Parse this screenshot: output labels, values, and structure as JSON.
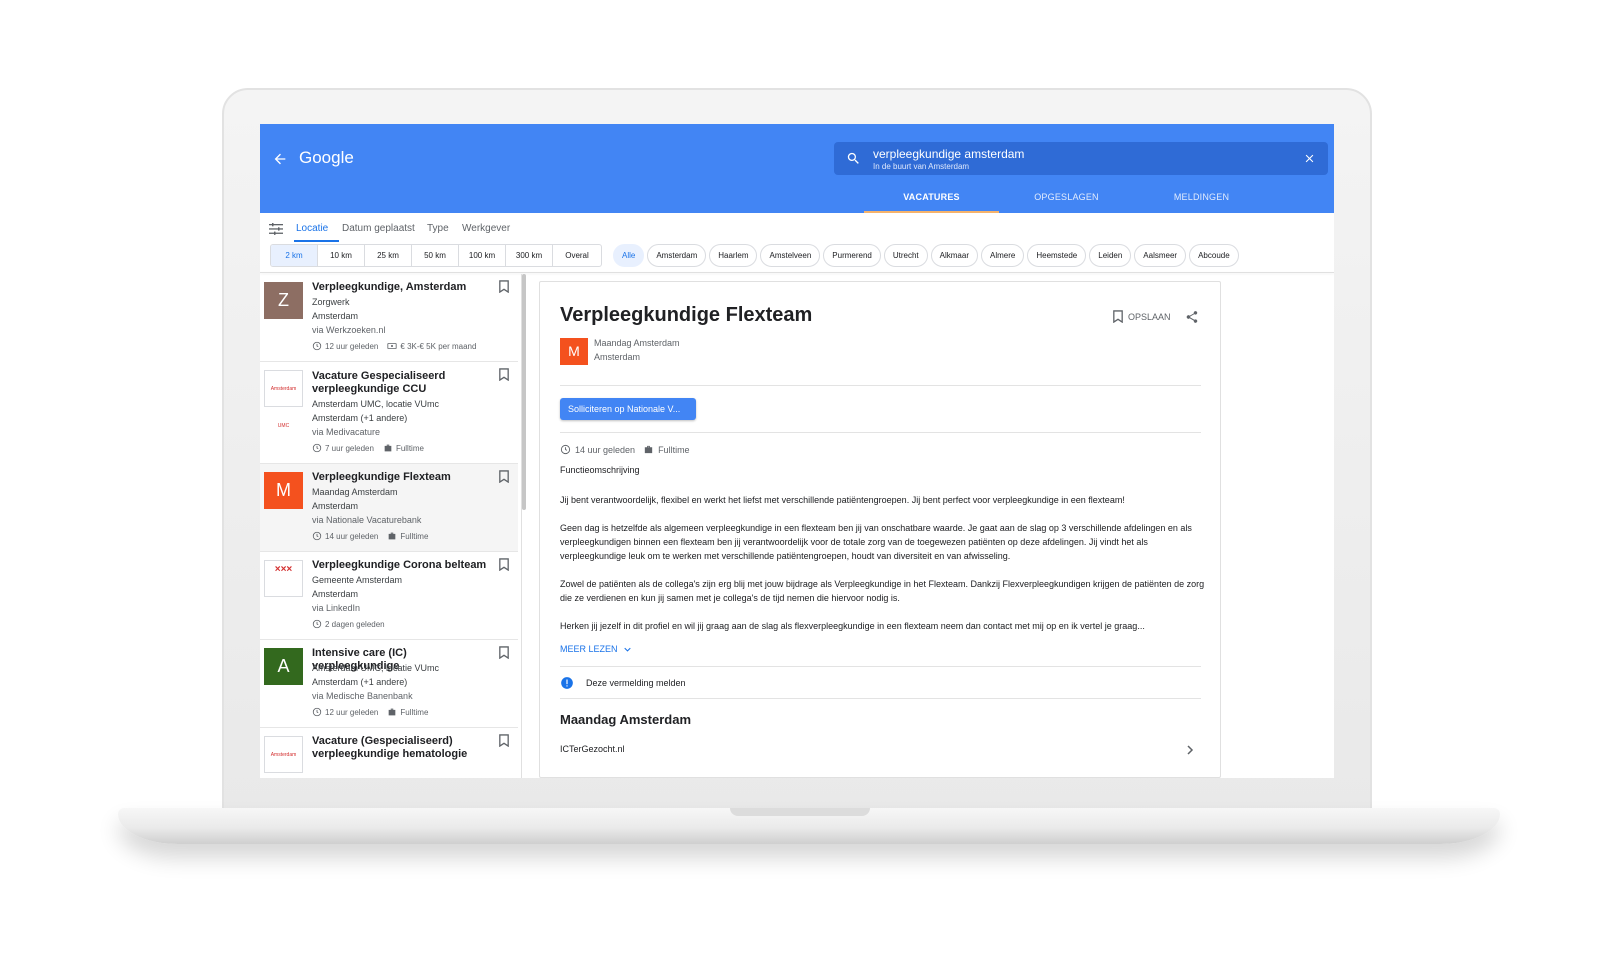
{
  "appbar": {
    "brand": "Google",
    "search_query": "verpleegkundige amsterdam",
    "search_sub": "In de buurt van Amsterdam",
    "tabs": [
      "VACATURES",
      "OPGESLAGEN",
      "MELDINGEN"
    ],
    "color": "#4285f4"
  },
  "filters": {
    "tabs": [
      "Locatie",
      "Datum geplaatst",
      "Type",
      "Werkgever"
    ],
    "distances": [
      "2 km",
      "10 km",
      "25 km",
      "50 km",
      "100 km",
      "300 km",
      "Overal"
    ],
    "chips": [
      "Alle",
      "Amsterdam",
      "Haarlem",
      "Amstelveen",
      "Purmerend",
      "Utrecht",
      "Alkmaar",
      "Almere",
      "Heemstede",
      "Leiden",
      "Aalsmeer",
      "Abcoude"
    ]
  },
  "jobs": [
    {
      "logo": "Z",
      "logo_color": "#8d6e63",
      "title": "Verpleegkundige, Amsterdam",
      "company": "Zorgwerk",
      "location": "Amsterdam",
      "source": "via Werkzoeken.nl",
      "time": "12 uur geleden",
      "extra": "€ 3K-€ 5K per maand"
    },
    {
      "logo": "Amsterdam UMC",
      "title": "Vacature Gespecialiseerd verpleegkundige CCU",
      "company": "Amsterdam UMC, locatie VUmc",
      "location": "Amsterdam (+1 andere)",
      "source": "via Medivacature",
      "time": "7 uur geleden",
      "extra": "Fulltime"
    },
    {
      "logo": "M",
      "logo_color": "#f4511e",
      "title": "Verpleegkundige Flexteam",
      "company": "Maandag Amsterdam",
      "location": "Amsterdam",
      "source": "via Nationale Vacaturebank",
      "time": "14 uur geleden",
      "extra": "Fulltime"
    },
    {
      "logo": "×××",
      "title": "Verpleegkundige Corona belteam",
      "company": "Gemeente Amsterdam",
      "location": "Amsterdam",
      "source": "via LinkedIn",
      "time": "2 dagen geleden"
    },
    {
      "logo": "A",
      "logo_color": "#33691e",
      "title": "Intensive care (IC) verpleegkundige",
      "company": "Amsterdam UMC, locatie VUmc",
      "location": "Amsterdam (+1 andere)",
      "source": "via Medische Banenbank",
      "time": "12 uur geleden",
      "extra": "Fulltime"
    },
    {
      "logo": "Amsterdam UMC",
      "title": "Vacature (Gespecialiseerd) verpleegkundige hematologie"
    }
  ],
  "detail": {
    "title": "Verpleegkundige Flexteam",
    "save": "OPSLAAN",
    "logo": "M",
    "company": "Maandag Amsterdam",
    "location": "Amsterdam",
    "apply": "Solliciteren op Nationale V...",
    "time": "14 uur geleden",
    "type": "Fulltime",
    "heading": "Functieomschrijving",
    "paragraphs": [
      "Jij bent verantwoordelijk, flexibel en werkt het liefst met verschillende patiëntengroepen. Jij bent perfect voor verpleegkundige in een flexteam!",
      "Geen dag is hetzelfde als algemeen verpleegkundige in een flexteam ben jij van onschatbare waarde. Je gaat aan de slag op 3 verschillende afdelingen en als verpleegkundigen binnen een flexteam ben jij verantwoordelijk voor de totale zorg van de toegewezen patiënten op deze afdelingen. Jij vindt het als verpleegkundige leuk om te werken met verschillende patiëntengroepen, houdt van diversiteit en van afwisseling.",
      "Zowel de patiënten als de collega's zijn erg blij met jouw bijdrage als Verpleegkundige in het Flexteam. Dankzij Flexverpleegkundigen krijgen de patiënten de zorg die ze verdienen en kun jij samen met je collega's de tijd nemen die hiervoor nodig is.",
      "Herken jij jezelf in dit profiel en wil jij graag aan de slag als flexverpleegkundige in een flexteam neem dan contact met mij op en ik vertel je graag..."
    ],
    "more": "MEER LEZEN",
    "report": "Deze vermelding melden",
    "section": "Maandag Amsterdam",
    "source_link": "ICTerGezocht.nl"
  }
}
